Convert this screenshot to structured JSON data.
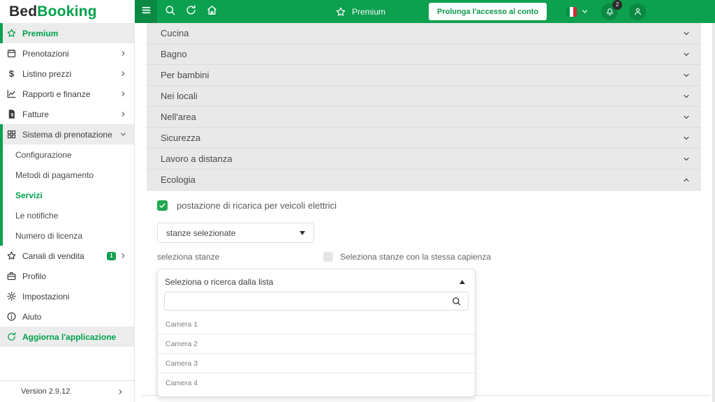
{
  "colors": {
    "topbar_green": "#0CA04F",
    "topbar_dark_green": "#0A8943",
    "brand_green": "#00A14B",
    "checkbox_green": "#21A84F",
    "badge_dark": "#2B2B2B",
    "flag_green": "#009246",
    "flag_red": "#CE2B37",
    "accordion_gray": "#E9E9E9"
  },
  "topbar": {
    "premium_label": "Premium",
    "extend_button_label": "Prolunga l'accesso al conto",
    "notification_count": "2",
    "icons": [
      "hamburger-icon",
      "search-icon",
      "refresh-icon",
      "home-icon",
      "star-icon",
      "flag-italy-icon",
      "chevron-down-icon",
      "bell-icon",
      "user-icon"
    ]
  },
  "sidebar": {
    "logo": {
      "part1": "Bed",
      "part2": "Booking"
    },
    "items": [
      {
        "label": "Premium",
        "icon": "star-icon"
      },
      {
        "label": "Prenotazioni",
        "icon": "calendar-icon",
        "chevron": "right"
      },
      {
        "label": "Listino prezzi",
        "icon": "dollar-icon",
        "chevron": "right"
      },
      {
        "label": "Rapporti e finanze",
        "icon": "chart-icon",
        "chevron": "right"
      },
      {
        "label": "Fatture",
        "icon": "invoice-icon",
        "chevron": "right"
      },
      {
        "label": "Sistema di prenotazione",
        "icon": "grid-icon",
        "chevron": "down",
        "expanded": true
      }
    ],
    "submenu": [
      {
        "label": "Configurazione",
        "active": false
      },
      {
        "label": "Metodi di pagamento",
        "active": false
      },
      {
        "label": "Servizi",
        "active": true
      },
      {
        "label": "Le notifiche",
        "active": false
      },
      {
        "label": "Numero di licenza",
        "active": false
      }
    ],
    "items_lower": [
      {
        "label": "Canali di vendita",
        "icon": "star-icon",
        "badge": "1",
        "chevron": "right"
      },
      {
        "label": "Profilo",
        "icon": "briefcase-icon"
      },
      {
        "label": "Impostazioni",
        "icon": "gear-icon"
      },
      {
        "label": "Aiuto",
        "icon": "info-icon"
      },
      {
        "label": "Aggiorna l'applicazione",
        "icon": "refresh-icon"
      }
    ],
    "version": "Version 2.9.12"
  },
  "main": {
    "categories": [
      {
        "label": "Cucina",
        "expanded": false
      },
      {
        "label": "Bagno",
        "expanded": false
      },
      {
        "label": "Per bambini",
        "expanded": false
      },
      {
        "label": "Nei locali",
        "expanded": false
      },
      {
        "label": "Nell'area",
        "expanded": false
      },
      {
        "label": "Sicurezza",
        "expanded": false
      },
      {
        "label": "Lavoro a distanza",
        "expanded": false
      },
      {
        "label": "Ecologia",
        "expanded": true
      }
    ],
    "ecologia": {
      "checkbox_label": "postazione di ricarica per veicoli elettrici",
      "checkbox_checked": true,
      "select_value": "stanze selezionate",
      "select_rooms_label": "seleziona stanze",
      "same_capacity_label": "Seleziona stanze con la stessa capienza",
      "same_capacity_checked": false,
      "dropdown": {
        "header": "Seleziona o ricerca dalla lista",
        "search_value": "",
        "rooms": [
          "Camera 1",
          "Camera 2",
          "Camera 3",
          "Camera 4"
        ]
      }
    }
  }
}
